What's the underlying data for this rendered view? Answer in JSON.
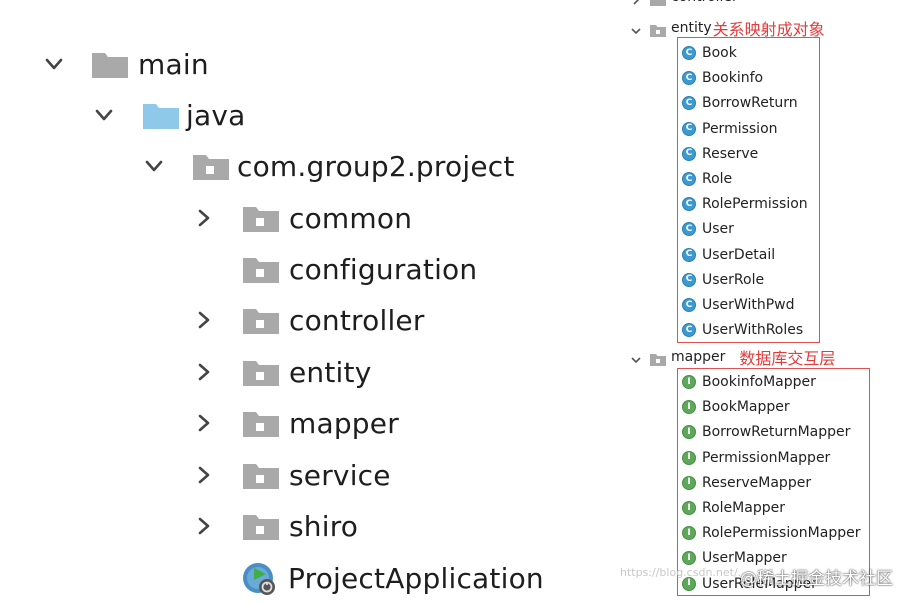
{
  "left_tree": {
    "items": [
      {
        "label": "main",
        "icon": "folder-icon",
        "expanded": true
      },
      {
        "label": "java",
        "icon": "source-folder-icon",
        "expanded": true
      },
      {
        "label": "com.group2.project",
        "icon": "package-icon",
        "expanded": true
      },
      {
        "label": "common",
        "icon": "package-icon",
        "expanded": false
      },
      {
        "label": "configuration",
        "icon": "package-icon",
        "expanded": null
      },
      {
        "label": "controller",
        "icon": "package-icon",
        "expanded": false
      },
      {
        "label": "entity",
        "icon": "package-icon",
        "expanded": false
      },
      {
        "label": "mapper",
        "icon": "package-icon",
        "expanded": false
      },
      {
        "label": "service",
        "icon": "package-icon",
        "expanded": false
      },
      {
        "label": "shiro",
        "icon": "package-icon",
        "expanded": false
      },
      {
        "label": "ProjectApplication",
        "icon": "spring-boot-app-icon",
        "expanded": null
      }
    ]
  },
  "right_tree": {
    "top_cut_label": "controller",
    "entity": {
      "label": "entity",
      "annotation": "关系映射成对象",
      "badge": "C",
      "items": [
        "Book",
        "Bookinfo",
        "BorrowReturn",
        "Permission",
        "Reserve",
        "Role",
        "RolePermission",
        "User",
        "UserDetail",
        "UserRole",
        "UserWithPwd",
        "UserWithRoles"
      ]
    },
    "mapper": {
      "label": "mapper",
      "annotation": "数据库交互层",
      "badge": "I",
      "items": [
        "BookinfoMapper",
        "BookMapper",
        "BorrowReturnMapper",
        "PermissionMapper",
        "ReserveMapper",
        "RoleMapper",
        "RolePermissionMapper",
        "UserMapper",
        "UserRoleMapper"
      ]
    }
  },
  "watermark": {
    "faint": "https://blog.csdn.net/...",
    "main": "@稀土掘金技术社区"
  },
  "colors": {
    "folder_gray": "#a9a9a9",
    "source_folder_blue": "#8ec9ea",
    "class_badge": "#3d9ad1",
    "interface_badge": "#5fa85b",
    "annotation_red": "#e23c3c",
    "box_red": "#e05252"
  }
}
